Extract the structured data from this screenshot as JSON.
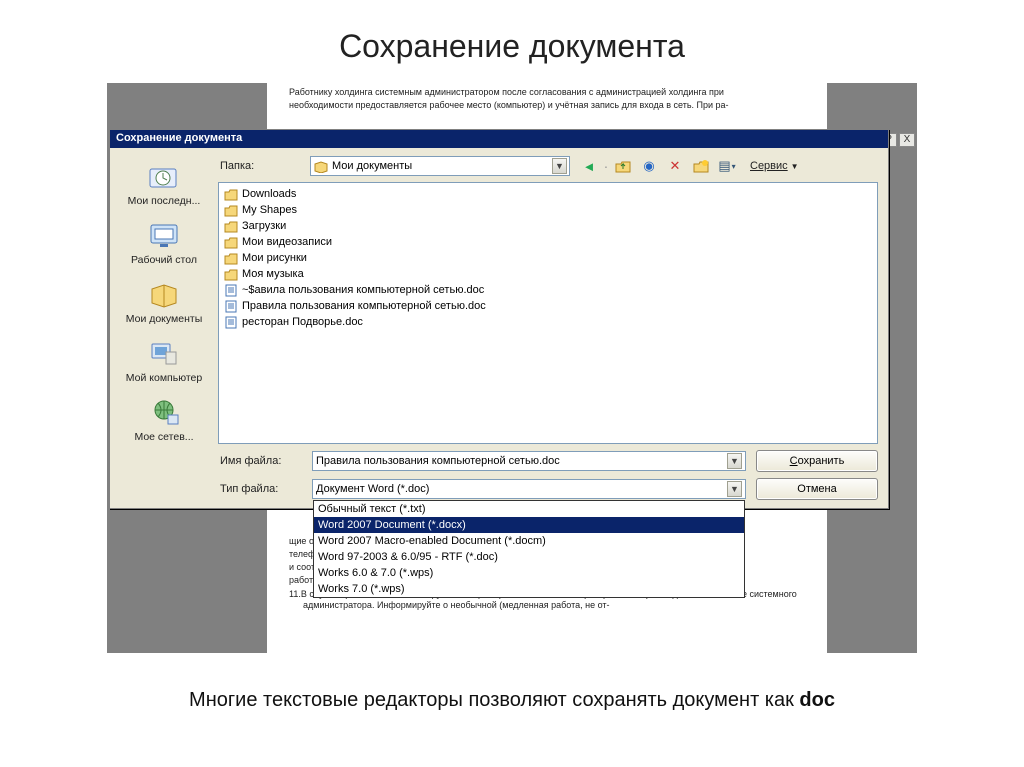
{
  "slide": {
    "title": "Сохранение документа",
    "caption_prefix": "Многие текстовые редакторы позволяют сохранять документ как ",
    "caption_bold": "doc"
  },
  "background_doc": {
    "line1": "Работнику холдинга системным администратором после согласования с администрацией холдинга при",
    "line2": "необходимости предоставляется рабочее место (компьютер) и учётная запись для входа в сеть. При ра-",
    "tail": [
      "щие обяз-",
      " ",
      "телефонов)",
      "и соответствует",
      "работы в др-"
    ],
    "item11": "11.В случае срабатывания антивирусной защиты (в том числе и блокиратора autorun) немедленно известите системного администратора. Информируйте о необычной (медленная работа, не от-"
  },
  "host_window": {
    "help": "?",
    "close": "X"
  },
  "dialog": {
    "title": "Сохранение документа",
    "folder_label": "Папка:",
    "folder_value": "Мои документы",
    "toolbar": {
      "back": "←",
      "up": "↑",
      "search": "🔍",
      "delete": "✕",
      "newfolder": "📁",
      "views": "▥",
      "service_label": "Сервис",
      "service_arrow": "▾"
    },
    "places": [
      {
        "label": "Мои последн...",
        "icon": "recent"
      },
      {
        "label": "Рабочий стол",
        "icon": "desktop"
      },
      {
        "label": "Мои документы",
        "icon": "mydocs"
      },
      {
        "label": "Мой компьютер",
        "icon": "mycomputer"
      },
      {
        "label": "Мое сетев...",
        "icon": "network"
      }
    ],
    "files": [
      {
        "name": "Downloads",
        "type": "folder"
      },
      {
        "name": "My Shapes",
        "type": "folder"
      },
      {
        "name": "Загрузки",
        "type": "folder"
      },
      {
        "name": "Мои видеозаписи",
        "type": "folder"
      },
      {
        "name": "Мои рисунки",
        "type": "folder"
      },
      {
        "name": "Моя музыка",
        "type": "folder"
      },
      {
        "name": "~$авила пользования компьютерной сетью.doc",
        "type": "doc"
      },
      {
        "name": "Правила пользования компьютерной сетью.doc",
        "type": "doc"
      },
      {
        "name": "ресторан Подворье.doc",
        "type": "doc"
      }
    ],
    "filename_label": "Имя файла:",
    "filename_value": "Правила пользования компьютерной сетью.doc",
    "filetype_label": "Тип файла:",
    "filetype_value": "Документ Word (*.doc)",
    "filetype_options": [
      "Обычный текст (*.txt)",
      "Word 2007 Document (*.docx)",
      "Word 2007 Macro-enabled Document (*.docm)",
      "Word 97-2003 & 6.0/95 - RTF (*.doc)",
      "Works 6.0 & 7.0 (*.wps)",
      "Works 7.0 (*.wps)"
    ],
    "filetype_selected_index": 1,
    "save_button": "Сохранить",
    "save_button_ul": "С",
    "cancel_button": "Отмена"
  }
}
